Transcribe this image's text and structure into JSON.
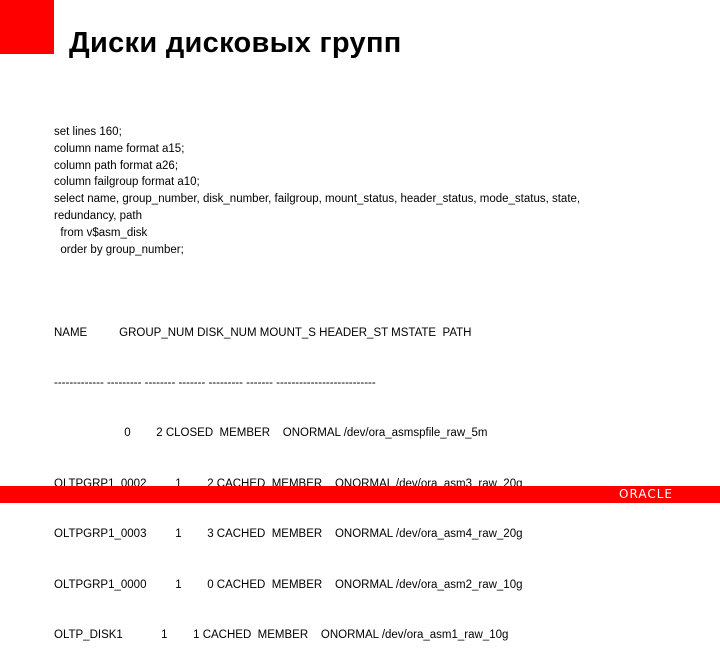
{
  "slide": {
    "title": "Диски дисковых групп",
    "accent_color": "#ff0000"
  },
  "query": {
    "lines": [
      "set lines 160;",
      "column name format a15;",
      "column path format a26;",
      "column failgroup format a10;",
      "select name, group_number, disk_number, failgroup, mount_status, header_status, mode_status, state, redundancy, path",
      "  from v$asm_disk",
      "  order by group_number;"
    ]
  },
  "output": {
    "header": "NAME          GROUP_NUM DISK_NUM MOUNT_S HEADER_ST MSTATE  PATH",
    "separator": "------------- --------- -------- ------- --------- ------- --------------------------",
    "rows": [
      "                      0        2 CLOSED  MEMBER    ONORMAL /dev/ora_asmspfile_raw_5m",
      "OLTPGRP1_0002         1        2 CACHED  MEMBER    ONORMAL /dev/ora_asm3_raw_20g",
      "OLTPGRP1_0003         1        3 CACHED  MEMBER    ONORMAL /dev/ora_asm4_raw_20g",
      "OLTPGRP1_0000         1        0 CACHED  MEMBER    ONORMAL /dev/ora_asm2_raw_10g",
      "OLTP_DISK1            1        1 CACHED  MEMBER    ONORMAL /dev/ora_asm1_raw_10g"
    ]
  },
  "footer": {
    "logo_text": "ORACLE"
  }
}
